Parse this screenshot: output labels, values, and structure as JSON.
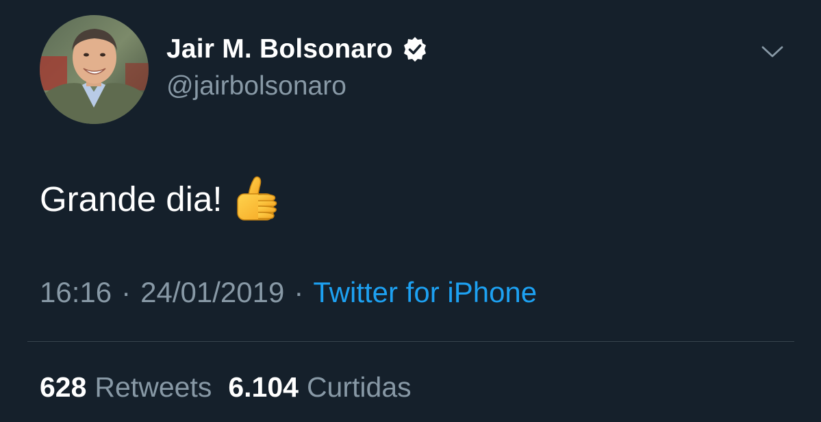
{
  "user": {
    "display_name": "Jair M. Bolsonaro",
    "handle": "@jairbolsonaro",
    "verified": true,
    "verified_icon": "verified-badge-icon",
    "avatar_icon": "profile-photo"
  },
  "tweet": {
    "text": "Grande dia!",
    "emoji_icon": "thumbs-up-emoji",
    "time": "16:16",
    "date": "24/01/2019",
    "separator": "·",
    "source": "Twitter for iPhone"
  },
  "stats": {
    "retweets_count": "628",
    "retweets_label": "Retweets",
    "likes_count": "6.104",
    "likes_label": "Curtidas"
  },
  "menu": {
    "icon": "chevron-down-icon"
  },
  "colors": {
    "background": "#15202b",
    "primary_text": "#ffffff",
    "secondary_text": "#8899a6",
    "link": "#1da1f2",
    "divider": "#38444d"
  }
}
